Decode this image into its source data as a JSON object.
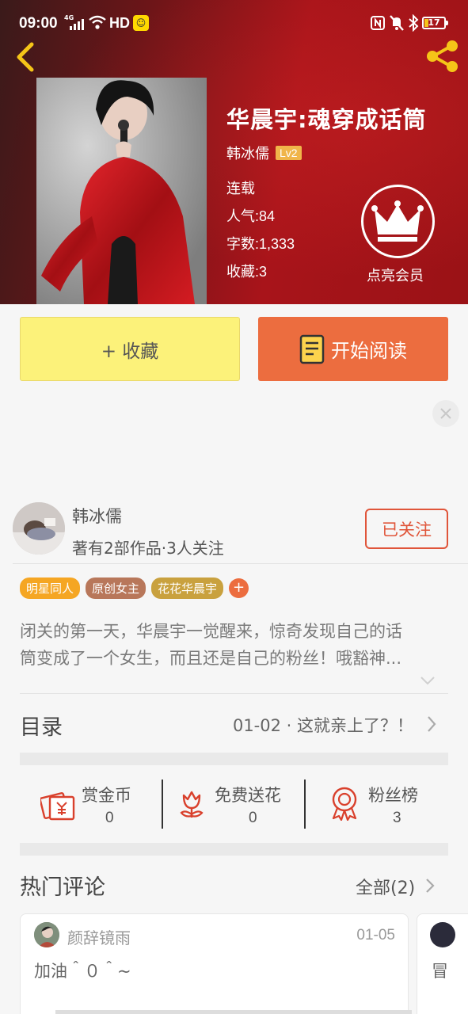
{
  "status_bar": {
    "time": "09:00",
    "network": "4G",
    "hd": "HD",
    "battery": "17"
  },
  "book": {
    "title": "华晨宇:魂穿成话筒",
    "author": "韩冰儒",
    "level": "Lv2",
    "status": "连载",
    "popularity_label": "人气:",
    "popularity": "84",
    "words_label": "字数:",
    "words": "1,333",
    "favorites_label": "收藏:",
    "favorites": "3"
  },
  "vip": {
    "label": "点亮会员"
  },
  "actions": {
    "favorite_label": "+ 收藏",
    "read_label": "开始阅读"
  },
  "author_card": {
    "name": "韩冰儒",
    "summary": "著有2部作品·3人关注",
    "follow_label": "已关注"
  },
  "tags": [
    {
      "label": "明星同人",
      "color": "#f5a623"
    },
    {
      "label": "原创女主",
      "color": "#b8775a"
    },
    {
      "label": "花花华晨宇",
      "color": "#c9a13e"
    }
  ],
  "tag_add": "+",
  "synopsis": {
    "line1": "闭关的第一天，华晨宇一觉醒来，惊奇发现自己的话",
    "line2": "筒变成了一个女生，而且还是自己的粉丝！哦豁神..."
  },
  "toc": {
    "title": "目录",
    "latest": "01-02 · 这就亲上了？！"
  },
  "stats": [
    {
      "label": "赏金币",
      "value": "0",
      "icon": "red-envelope-icon"
    },
    {
      "label": "免费送花",
      "value": "0",
      "icon": "flower-icon"
    },
    {
      "label": "粉丝榜",
      "value": "3",
      "icon": "medal-icon"
    }
  ],
  "comments": {
    "title": "热门评论",
    "all_label": "全部(2)",
    "items": [
      {
        "user": "颜辞镜雨",
        "date": "01-05",
        "text": "加油＾０＾~"
      },
      {
        "text": "冒"
      }
    ]
  },
  "colors": {
    "accent_orange": "#ec6d3f",
    "favorite_yellow": "#fcf27a",
    "follow_red": "#e0553a",
    "level_gold": "#f0b54a"
  }
}
